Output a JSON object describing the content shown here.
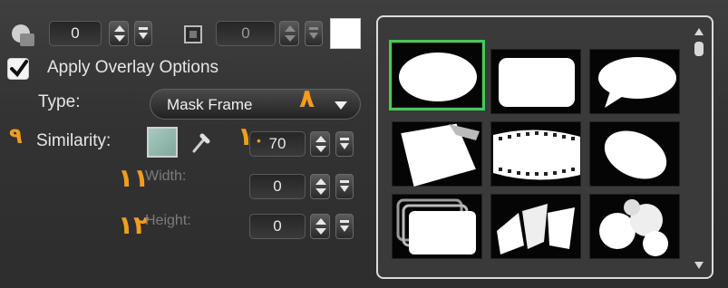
{
  "top_row": {
    "left_value": "0",
    "right_value": "0",
    "icons": [
      "overlay-shape-icon",
      "frame-square-icon"
    ],
    "color_swatch": "#ffffff"
  },
  "apply_overlay": {
    "label": "Apply Overlay Options",
    "checked": true
  },
  "type": {
    "label": "Type:",
    "value": "Mask Frame"
  },
  "similarity": {
    "label": "Similarity:",
    "value": "70",
    "swatch_color": "#9dbfb4"
  },
  "width": {
    "label": "Width:",
    "value": "0"
  },
  "height": {
    "label": "Height:",
    "value": "0"
  },
  "annotations": {
    "a8": "۸",
    "a9": "۹",
    "a10": "۱",
    "a11": "۱۱",
    "a12": "۱۲"
  },
  "gallery": {
    "items": [
      "ellipse-mask",
      "rounded-rectangle-mask",
      "speech-bubble-mask",
      "torn-paper-mask",
      "film-strip-mask",
      "soft-ellipse-mask",
      "stacked-frames-mask",
      "shards-mask",
      "bubbles-mask"
    ],
    "selected_index": 0,
    "selection_color": "#46c85a"
  }
}
